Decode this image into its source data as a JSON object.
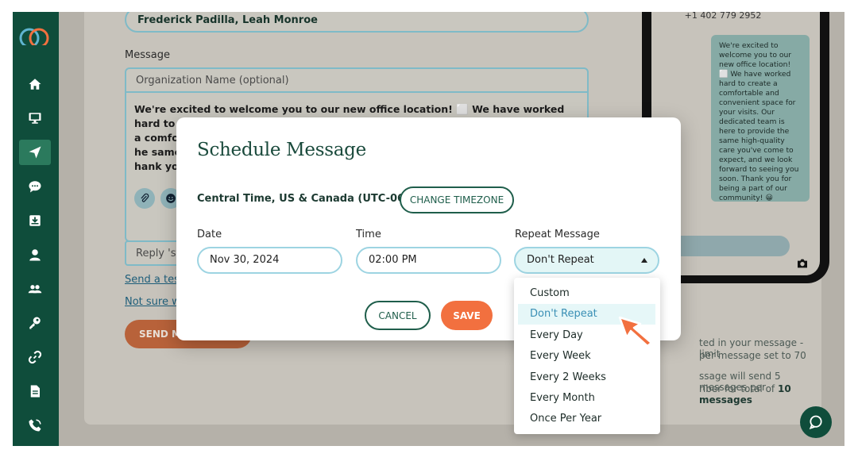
{
  "colors": {
    "sidebar": "#0f4d3b",
    "sidebar_active": "#2b7a5d",
    "brand_green": "#1f5e4b",
    "accent_orange": "#f2703f",
    "input_border": "#9dd4e2",
    "selected_option_text": "#3a8fb5"
  },
  "sidebar": {
    "items": [
      {
        "icon": "home-icon"
      },
      {
        "icon": "monitor-icon"
      },
      {
        "icon": "send-icon",
        "active": true
      },
      {
        "icon": "chat-bubble-icon"
      },
      {
        "icon": "inbox-icon"
      },
      {
        "icon": "person-icon"
      },
      {
        "icon": "group-icon"
      },
      {
        "icon": "key-icon"
      },
      {
        "icon": "link-icon"
      },
      {
        "icon": "document-icon"
      },
      {
        "icon": "phone-icon"
      }
    ]
  },
  "form": {
    "recipients": "Frederick Padilla, Leah Monroe",
    "message_label": "Message",
    "org_placeholder": "Organization Name (optional)",
    "message_lines": [
      "We're excited to welcome you to our new office location! ⬜ We have worked hard to create",
      "a comfortable",
      "he same high-",
      "hank you for b"
    ],
    "reply_hint": "Reply 'stop' to",
    "test_link": "Send a test mes",
    "help_link": "Not sure what to",
    "send_label": "SEND MESSAGE"
  },
  "preview": {
    "phone_number": "+1 402 779 2952",
    "bubble_text": "We're excited to welcome you to our new office location! ⬜ We have worked hard to create a comfortable and convenient space for your visits. Our dedicated team is here to provide the same high-quality care you've come to expect, and we look forward to seeing you soon. Thank you for being a part of our community! 😀",
    "side_line_1": "ted in your message - limit",
    "side_line_2": "per message set to 70",
    "side_line_3": "ssage will send 5 messages per",
    "side_line_4_prefix": "riber for total of ",
    "side_line_4_bold": "10 messages"
  },
  "modal": {
    "title": "Schedule Message",
    "timezone": "Central Time, US & Canada (UTC-06:00)",
    "change_timezone_label": "CHANGE TIMEZONE",
    "date_label": "Date",
    "date_value": "Nov 30, 2024",
    "time_label": "Time",
    "time_value": "02:00 PM",
    "repeat_label": "Repeat Message",
    "repeat_value": "Don't Repeat",
    "cancel_label": "CANCEL",
    "save_label": "SAVE"
  },
  "repeat_options": [
    {
      "label": "Custom"
    },
    {
      "label": "Don't Repeat",
      "selected": true
    },
    {
      "label": "Every Day"
    },
    {
      "label": "Every Week"
    },
    {
      "label": "Every 2 Weeks"
    },
    {
      "label": "Every Month"
    },
    {
      "label": "Once Per Year"
    }
  ]
}
